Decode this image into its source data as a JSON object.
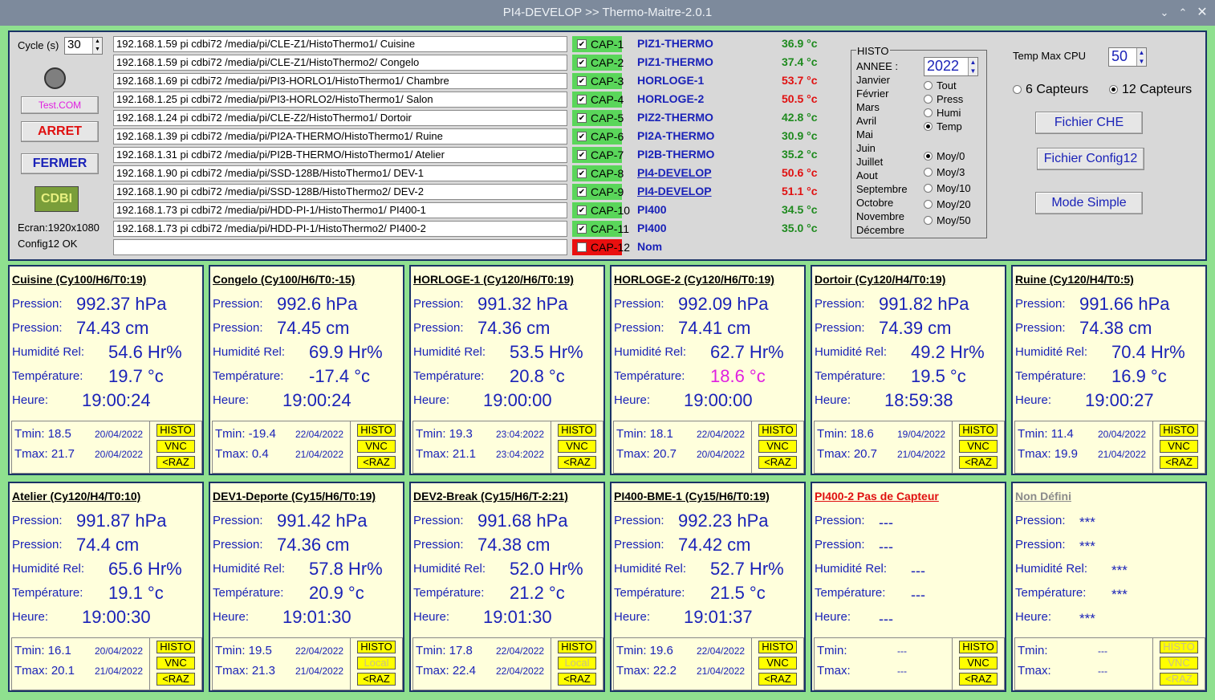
{
  "window": {
    "title": "PI4-DEVELOP >> Thermo-Maitre-2.0.1",
    "min_icon": "chevron-down",
    "max_icon": "chevron-up",
    "close_icon": "close"
  },
  "controls": {
    "cycle_label": "Cycle (s)",
    "cycle_value": "30",
    "test_label": "Test.COM",
    "arret_label": "ARRET",
    "fermer_label": "FERMER",
    "logo_text": "CDBI",
    "ecran_label": "Ecran:1920x1080",
    "config_label": "Config12 OK"
  },
  "captors": [
    {
      "path": "192.168.1.59 pi cdbi72 /media/pi/CLE-Z1/HistoThermo1/ Cuisine",
      "cap": "CAP-1",
      "checked": true,
      "name": "PIZ1-THERMO",
      "underline": false,
      "temp": "36.9 °c",
      "temp_color": "#1e8a1e"
    },
    {
      "path": "192.168.1.59 pi cdbi72 /media/pi/CLE-Z1/HistoThermo2/ Congelo",
      "cap": "CAP-2",
      "checked": true,
      "name": "PIZ1-THERMO",
      "underline": false,
      "temp": "37.4 °c",
      "temp_color": "#1e8a1e"
    },
    {
      "path": "192.168.1.69 pi cdbi72 /media/pi/PI3-HORLO1/HistoThermo1/ Chambre",
      "cap": "CAP-3",
      "checked": true,
      "name": "HORLOGE-1",
      "underline": false,
      "temp": "53.7 °c",
      "temp_color": "#e01010"
    },
    {
      "path": "192.168.1.25 pi cdbi72 /media/pi/PI3-HORLO2/HistoThermo1/ Salon",
      "cap": "CAP-4",
      "checked": true,
      "name": "HORLOGE-2",
      "underline": false,
      "temp": "50.5 °c",
      "temp_color": "#e01010"
    },
    {
      "path": "192.168.1.24 pi cdbi72 /media/pi/CLE-Z2/HistoThermo1/ Dortoir",
      "cap": "CAP-5",
      "checked": true,
      "name": "PIZ2-THERMO",
      "underline": false,
      "temp": "42.8 °c",
      "temp_color": "#1e8a1e"
    },
    {
      "path": "192.168.1.39 pi cdbi72 /media/pi/PI2A-THERMO/HistoThermo1/ Ruine",
      "cap": "CAP-6",
      "checked": true,
      "name": "PI2A-THERMO",
      "underline": false,
      "temp": "30.9 °c",
      "temp_color": "#1e8a1e"
    },
    {
      "path": "192.168.1.31 pi cdbi72 /media/pi/PI2B-THERMO/HistoThermo1/ Atelier",
      "cap": "CAP-7",
      "checked": true,
      "name": "PI2B-THERMO",
      "underline": false,
      "temp": "35.2 °c",
      "temp_color": "#1e8a1e"
    },
    {
      "path": "192.168.1.90 pi cdbi72 /media/pi/SSD-128B/HistoThermo1/ DEV-1",
      "cap": "CAP-8",
      "checked": true,
      "name": "PI4-DEVELOP",
      "underline": true,
      "temp": "50.6 °c",
      "temp_color": "#e01010"
    },
    {
      "path": "192.168.1.90 pi cdbi72 /media/pi/SSD-128B/HistoThermo2/ DEV-2",
      "cap": "CAP-9",
      "checked": true,
      "name": "PI4-DEVELOP",
      "underline": true,
      "temp": "51.1 °c",
      "temp_color": "#e01010"
    },
    {
      "path": "192.168.1.73 pi cdbi72 /media/pi/HDD-PI-1/HistoThermo1/ PI400-1",
      "cap": "CAP-10",
      "checked": true,
      "name": "PI400",
      "underline": false,
      "temp": "34.5 °c",
      "temp_color": "#1e8a1e"
    },
    {
      "path": "192.168.1.73 pi cdbi72 /media/pi/HDD-PI-1/HistoThermo2/ PI400-2",
      "cap": "CAP-11",
      "checked": true,
      "name": "PI400",
      "underline": false,
      "temp": "35.0 °c",
      "temp_color": "#1e8a1e"
    },
    {
      "path": "",
      "cap": "CAP-12",
      "checked": false,
      "name": "Nom",
      "underline": false,
      "temp": "",
      "temp_color": "#1e8a1e"
    }
  ],
  "histo": {
    "title": "HISTO",
    "annee_label": "ANNEE :",
    "year": "2022",
    "months": [
      "Janvier",
      "Février",
      "Mars",
      "Avril",
      "Mai",
      "Juin",
      "Juillet",
      "Aout",
      "Septembre",
      "Octobre",
      "Novembre",
      "Décembre"
    ],
    "types": [
      {
        "label": "Tout",
        "on": false
      },
      {
        "label": "Press",
        "on": false
      },
      {
        "label": "Humi",
        "on": false
      },
      {
        "label": "Temp",
        "on": true
      }
    ],
    "moy": [
      {
        "label": "Moy/0",
        "on": true
      },
      {
        "label": "Moy/3",
        "on": false
      },
      {
        "label": "Moy/10",
        "on": false
      },
      {
        "label": "Moy/20",
        "on": false
      },
      {
        "label": "Moy/50",
        "on": false
      }
    ]
  },
  "right": {
    "cpu_label": "Temp Max CPU",
    "cpu_value": "50",
    "six_label": "6 Capteurs",
    "six_on": false,
    "twelve_label": "12 Capteurs",
    "twelve_on": true,
    "che_label": "Fichier CHE",
    "config_label": "Fichier Config12",
    "mode_label": "Mode Simple"
  },
  "panels": [
    {
      "title": "Cuisine  (Cy100/H6/T0:19)",
      "title_color": "#000000",
      "l1": "Pression:",
      "v1": "992.37 hPa",
      "l2": "Pression:",
      "v2": "74.43 cm",
      "l3": "Humidité Rel:",
      "v3": "54.6 Hr%",
      "l4": "Température:",
      "v4": "19.7 °c",
      "v4_color": "#1a22b8",
      "l5": "Heure:",
      "v5": "19:00:24",
      "tmin": "Tmin: 18.5",
      "tmin_date": "20/04/2022",
      "tmax": "Tmax: 21.7",
      "tmax_date": "20/04/2022",
      "b1": "HISTO",
      "b2": "VNC",
      "b3": "<RAZ",
      "b1_dim": false,
      "b2_dim": false,
      "b3_dim": false
    },
    {
      "title": "Congelo  (Cy100/H6/T0:-15)",
      "title_color": "#000000",
      "l1": "Pression:",
      "v1": "992.6 hPa",
      "l2": "Pression:",
      "v2": "74.45 cm",
      "l3": "Humidité Rel:",
      "v3": "69.9 Hr%",
      "l4": "Température:",
      "v4": "-17.4 °c",
      "v4_color": "#1a22b8",
      "l5": "Heure:",
      "v5": "19:00:24",
      "tmin": "Tmin: -19.4",
      "tmin_date": "22/04/2022",
      "tmax": "Tmax: 0.4",
      "tmax_date": "21/04/2022",
      "b1": "HISTO",
      "b2": "VNC",
      "b3": "<RAZ",
      "b1_dim": false,
      "b2_dim": false,
      "b3_dim": false
    },
    {
      "title": "HORLOGE-1  (Cy120/H6/T0:19)",
      "title_color": "#000000",
      "l1": "Pression:",
      "v1": "991.32 hPa",
      "l2": "Pression:",
      "v2": "74.36 cm",
      "l3": "Humidité Rel:",
      "v3": "53.5 Hr%",
      "l4": "Température:",
      "v4": "20.8 °c",
      "v4_color": "#1a22b8",
      "l5": "Heure:",
      "v5": "19:00:00",
      "tmin": "Tmin: 19.3",
      "tmin_date": "23:04:2022",
      "tmax": "Tmax: 21.1",
      "tmax_date": "23:04:2022",
      "b1": "HISTO",
      "b2": "VNC",
      "b3": "<RAZ",
      "b1_dim": false,
      "b2_dim": false,
      "b3_dim": false
    },
    {
      "title": "HORLOGE-2  (Cy120/H6/T0:19)",
      "title_color": "#000000",
      "l1": "Pression:",
      "v1": "992.09 hPa",
      "l2": "Pression:",
      "v2": "74.41 cm",
      "l3": "Humidité Rel:",
      "v3": "62.7 Hr%",
      "l4": "Température:",
      "v4": "18.6 °c",
      "v4_color": "#e020e0",
      "l5": "Heure:",
      "v5": "19:00:00",
      "tmin": "Tmin: 18.1",
      "tmin_date": "22/04/2022",
      "tmax": "Tmax: 20.7",
      "tmax_date": "20/04/2022",
      "b1": "HISTO",
      "b2": "VNC",
      "b3": "<RAZ",
      "b1_dim": false,
      "b2_dim": false,
      "b3_dim": false
    },
    {
      "title": "Dortoir  (Cy120/H4/T0:19)",
      "title_color": "#000000",
      "l1": "Pression:",
      "v1": "991.82 hPa",
      "l2": "Pression:",
      "v2": "74.39 cm",
      "l3": "Humidité Rel:",
      "v3": "49.2 Hr%",
      "l4": "Température:",
      "v4": "19.5 °c",
      "v4_color": "#1a22b8",
      "l5": "Heure:",
      "v5": "18:59:38",
      "tmin": "Tmin: 18.6",
      "tmin_date": "19/04/2022",
      "tmax": "Tmax: 20.7",
      "tmax_date": "21/04/2022",
      "b1": "HISTO",
      "b2": "VNC",
      "b3": "<RAZ",
      "b1_dim": false,
      "b2_dim": false,
      "b3_dim": false
    },
    {
      "title": "Ruine  (Cy120/H4/T0:5)",
      "title_color": "#000000",
      "l1": "Pression:",
      "v1": "991.66 hPa",
      "l2": "Pression:",
      "v2": "74.38 cm",
      "l3": "Humidité Rel:",
      "v3": "70.4 Hr%",
      "l4": "Température:",
      "v4": "16.9 °c",
      "v4_color": "#1a22b8",
      "l5": "Heure:",
      "v5": "19:00:27",
      "tmin": "Tmin: 11.4",
      "tmin_date": "20/04/2022",
      "tmax": "Tmax: 19.9",
      "tmax_date": "21/04/2022",
      "b1": "HISTO",
      "b2": "VNC",
      "b3": "<RAZ",
      "b1_dim": false,
      "b2_dim": false,
      "b3_dim": false
    },
    {
      "title": "Atelier  (Cy120/H4/T0:10)",
      "title_color": "#000000",
      "l1": "Pression:",
      "v1": "991.87 hPa",
      "l2": "Pression:",
      "v2": "74.4 cm",
      "l3": "Humidité Rel:",
      "v3": "65.6 Hr%",
      "l4": "Température:",
      "v4": "19.1 °c",
      "v4_color": "#1a22b8",
      "l5": "Heure:",
      "v5": "19:00:30",
      "tmin": "Tmin: 16.1",
      "tmin_date": "20/04/2022",
      "tmax": "Tmax: 20.1",
      "tmax_date": "21/04/2022",
      "b1": "HISTO",
      "b2": "VNC",
      "b3": "<RAZ",
      "b1_dim": false,
      "b2_dim": false,
      "b3_dim": false
    },
    {
      "title": "DEV1-Deporte  (Cy15/H6/T0:19)",
      "title_color": "#000000",
      "l1": "Pression:",
      "v1": "991.42 hPa",
      "l2": "Pression:",
      "v2": "74.36 cm",
      "l3": "Humidité Rel:",
      "v3": "57.8 Hr%",
      "l4": "Température:",
      "v4": "20.9 °c",
      "v4_color": "#1a22b8",
      "l5": "Heure:",
      "v5": "19:01:30",
      "tmin": "Tmin: 19.5",
      "tmin_date": "22/04/2022",
      "tmax": "Tmax: 21.3",
      "tmax_date": "21/04/2022",
      "b1": "HISTO",
      "b2": "Local",
      "b3": "<RAZ",
      "b1_dim": false,
      "b2_dim": true,
      "b3_dim": false
    },
    {
      "title": "DEV2-Break  (Cy15/H6/T-2:21)",
      "title_color": "#000000",
      "l1": "Pression:",
      "v1": "991.68 hPa",
      "l2": "Pression:",
      "v2": "74.38 cm",
      "l3": "Humidité Rel:",
      "v3": "52.0 Hr%",
      "l4": "Température:",
      "v4": "21.2 °c",
      "v4_color": "#1a22b8",
      "l5": "Heure:",
      "v5": "19:01:30",
      "tmin": "Tmin: 17.8",
      "tmin_date": "22/04/2022",
      "tmax": "Tmax: 22.4",
      "tmax_date": "22/04/2022",
      "b1": "HISTO",
      "b2": "Local",
      "b3": "<RAZ",
      "b1_dim": false,
      "b2_dim": true,
      "b3_dim": false
    },
    {
      "title": "PI400-BME-1  (Cy15/H6/T0:19)",
      "title_color": "#000000",
      "l1": "Pression:",
      "v1": "992.23 hPa",
      "l2": "Pression:",
      "v2": "74.42 cm",
      "l3": "Humidité Rel:",
      "v3": "52.7 Hr%",
      "l4": "Température:",
      "v4": "21.5 °c",
      "v4_color": "#1a22b8",
      "l5": "Heure:",
      "v5": "19:01:37",
      "tmin": "Tmin: 19.6",
      "tmin_date": "22/04/2022",
      "tmax": "Tmax: 22.2",
      "tmax_date": "21/04/2022",
      "b1": "HISTO",
      "b2": "VNC",
      "b3": "<RAZ",
      "b1_dim": false,
      "b2_dim": false,
      "b3_dim": false
    },
    {
      "title": "PI400-2 Pas de Capteur",
      "title_color": "#e01010",
      "l1": "Pression:",
      "v1": "---",
      "l2": "Pression:",
      "v2": "---",
      "l3": "Humidité Rel:",
      "v3": "---",
      "l4": "Température:",
      "v4": "---",
      "v4_color": "#1a22b8",
      "l5": "Heure:",
      "v5": "---",
      "tmin": "Tmin:",
      "tmin_date": "---",
      "tmax": "Tmax:",
      "tmax_date": "---",
      "b1": "HISTO",
      "b2": "VNC",
      "b3": "<RAZ",
      "b1_dim": false,
      "b2_dim": false,
      "b3_dim": false
    },
    {
      "title": "Non Défini",
      "title_color": "#8a8a8a",
      "l1": "Pression:",
      "v1": "***",
      "l2": "Pression:",
      "v2": "***",
      "l3": "Humidité Rel:",
      "v3": "***",
      "l4": "Température:",
      "v4": "***",
      "v4_color": "#1a22b8",
      "l5": "Heure:",
      "v5": "***",
      "tmin": "Tmin:",
      "tmin_date": "---",
      "tmax": "Tmax:",
      "tmax_date": "---",
      "b1": "HISTO",
      "b2": "VNC",
      "b3": "<RAZ",
      "b1_dim": true,
      "b2_dim": true,
      "b3_dim": true
    }
  ]
}
